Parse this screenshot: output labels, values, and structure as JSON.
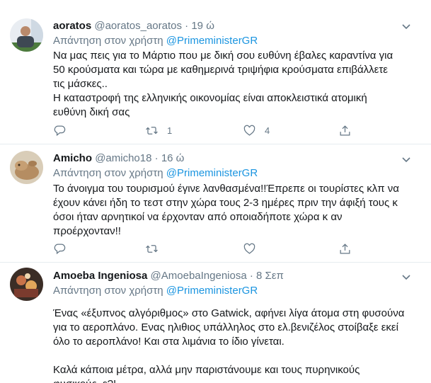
{
  "tweets": [
    {
      "name": "aoratos",
      "handle": "@aoratos_aoratos",
      "dot": "·",
      "time": "19 ώ",
      "reply_prefix": "Απάντηση στον χρήστη",
      "mention": "@PrimeministerGR",
      "lines": [
        "Να μας πεις για το Μάρτιο που με δική σου ευθύνη έβαλες καραντίνα για",
        "50 κρούσματα και τώρα με καθημερινά τριψήφια κρούσματα επιβάλλετε",
        "τις μάσκες..",
        "Η καταστροφή της ελληνικής οικονομίας είναι αποκλειστικά ατομική",
        "ευθύνη δική σας"
      ],
      "retweet_count": "1",
      "like_count": "4"
    },
    {
      "name": "Amicho",
      "handle": "@amicho18",
      "dot": "·",
      "time": "16 ώ",
      "reply_prefix": "Απάντηση στον χρήστη",
      "mention": "@PrimeministerGR",
      "lines": [
        "Το άνοιγμα του τουρισμού έγινε λανθασμένα!!Έπρεπε οι τουρίστες κλπ να",
        "έχουν κάνει ήδη το τεστ στην χώρα τους 2-3 ημέρες πριν την άφιξή τους κ",
        "όσοι ήταν αρνητικοί να έρχονταν από οποιαδήποτε χώρα κ αν",
        "προέρχονταν!!"
      ],
      "retweet_count": "",
      "like_count": ""
    },
    {
      "name": "Amoeba Ingeniosa",
      "handle": "@AmoebaIngeniosa",
      "dot": "·",
      "time": "8 Σεπ",
      "reply_prefix": "Απάντηση στον χρήστη",
      "mention": "@PrimeministerGR",
      "lines": [
        "Ένας «έξυπνος αλγόριθμος» στο Gatwick, αφήνει λίγα άτομα στη φυσούνα",
        "για το αεροπλάνο. Ενας ηλιθιος υπάλληλος στο ελ.βενιζέλος στοίβαξε εκεί",
        "όλο το αεροπλάνο! Και στα λιμάνια το ίδιο γίνεται.",
        "",
        "Καλά κάποια μέτρα, αλλά μην παριστάνουμε και τους πυρηνικούς",
        "φυσικούς, ε?!"
      ],
      "retweet_count": "",
      "like_count": ""
    }
  ],
  "colors": {
    "link": "#1b95e0",
    "muted": "#657786",
    "text": "#14171a",
    "divider": "#e6ecf0"
  },
  "icons": {
    "reply": "reply-icon",
    "retweet": "retweet-icon",
    "like": "heart-icon",
    "share": "share-icon",
    "more": "chevron-down-icon"
  }
}
